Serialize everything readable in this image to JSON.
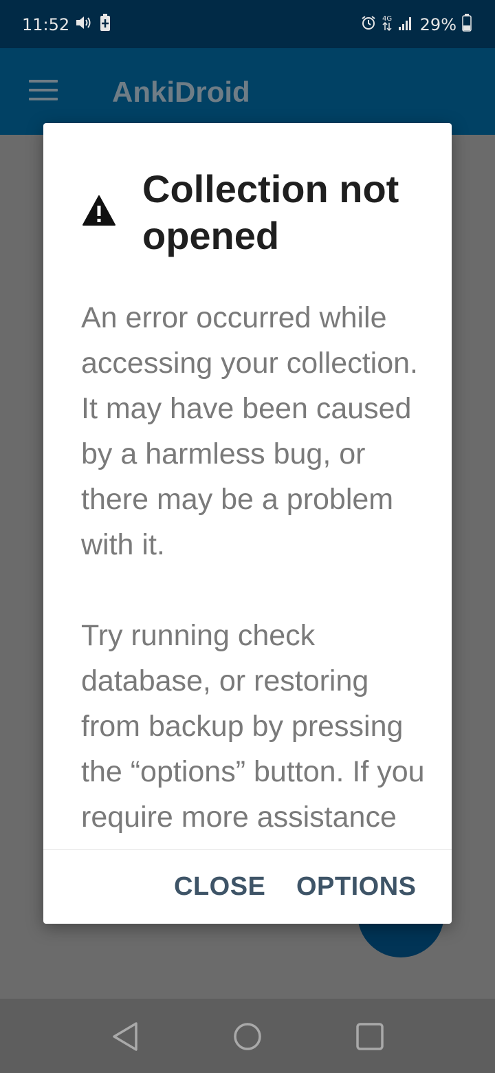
{
  "status_bar": {
    "time": "11:52",
    "battery_percent": "29%",
    "left_icons": [
      "volume-icon",
      "battery-saver-icon"
    ],
    "right_icons": [
      "alarm-icon",
      "data-network-icon",
      "signal-icon",
      "battery-icon"
    ]
  },
  "app_bar": {
    "title": "AnkiDroid",
    "menu_icon": "hamburger-menu-icon"
  },
  "dialog": {
    "icon": "warning-icon",
    "title": "Collection not opened",
    "body_paragraph_1": "An error occurred while accessing your collection. It may have been caused by a harmless bug, or there may be a problem with it.",
    "body_paragraph_2": "Try running check database, or restoring from backup by pressing the “options” button. If you require more assistance",
    "buttons": {
      "close": "CLOSE",
      "options": "OPTIONS"
    }
  },
  "nav_bar": {
    "icons": [
      "back-icon",
      "home-icon",
      "recents-icon"
    ]
  },
  "colors": {
    "status_bar": "#012a46",
    "app_bar": "#014164",
    "scrim": "#6b6b6b",
    "dialog_bg": "#ffffff",
    "button_text": "#3e5467",
    "fab": "#013456"
  }
}
